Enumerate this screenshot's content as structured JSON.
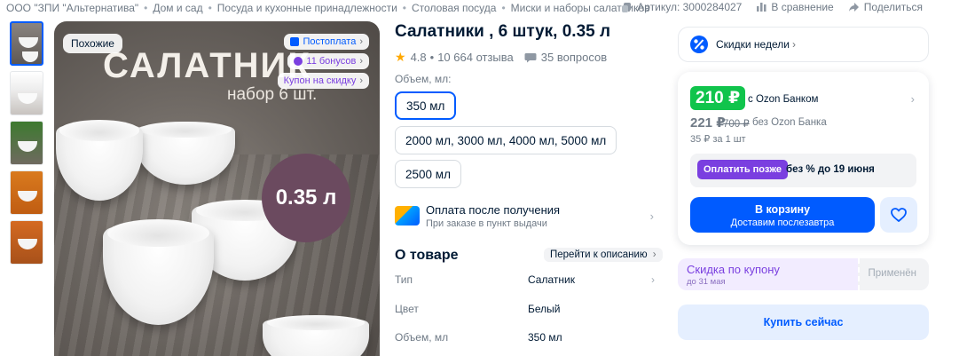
{
  "breadcrumbs": [
    "ООО \"ЗПИ \"Альтернатива\"",
    "Дом и сад",
    "Посуда и кухонные принадлежности",
    "Столовая посуда",
    "Миски и наборы салатников"
  ],
  "header_actions": {
    "article_label": "Артикул: 3000284027",
    "compare_label": "В сравнение",
    "share_label": "Поделиться"
  },
  "gallery": {
    "similar_label": "Похожие",
    "image_title": "САЛАТНИК",
    "image_subtitle": "набор 6 шт.",
    "volume_text": "0.35 л",
    "badges": [
      "Постоплата",
      "11 бонусов",
      "Купон на скидку"
    ],
    "thumb_count_shown": 5
  },
  "product": {
    "title": "Салатники , 6 штук, 0.35 л",
    "rating": "4.8",
    "reviews": "10 664 отзыва",
    "questions": "35 вопросов",
    "volume_label": "Объем, мл:",
    "options": [
      "350 мл",
      "2000 мл, 3000 мл, 4000 мл, 5000 мл",
      "2500 мл"
    ],
    "selected_option": "350 мл",
    "pay_after_title": "Оплата после получения",
    "pay_after_sub": "При заказе в пункт выдачи",
    "about_title": "О товаре",
    "to_description": "Перейти к описанию",
    "characteristics": [
      {
        "key": "Тип",
        "value": "Салатник"
      },
      {
        "key": "Цвет",
        "value": "Белый"
      },
      {
        "key": "Объем, мл",
        "value": "350 мл"
      }
    ]
  },
  "buybox": {
    "weekly_deals": "Скидки недели",
    "price_ozon_bank": "210 ₽",
    "ozon_bank_label": "с Ozon Банком",
    "price_regular": "221 ₽",
    "price_old": "700 ₽",
    "no_bank_label": "без Ozon Банка",
    "per_unit": "35 ₽ за 1 шт",
    "pay_later_button": "Оплатить позже",
    "pay_later_text": "без % до 19 июня",
    "cart_label": "В корзину",
    "cart_sub": "Доставим послезавтра",
    "coupon_title": "Скидка по купону",
    "coupon_date": "до 31 мая",
    "coupon_applied": "Применён",
    "buy_now": "Купить сейчас"
  },
  "colors": {
    "accent": "#005bff",
    "green_price": "#10c44c",
    "purple": "#7a3fe0",
    "star": "#ffa800"
  }
}
